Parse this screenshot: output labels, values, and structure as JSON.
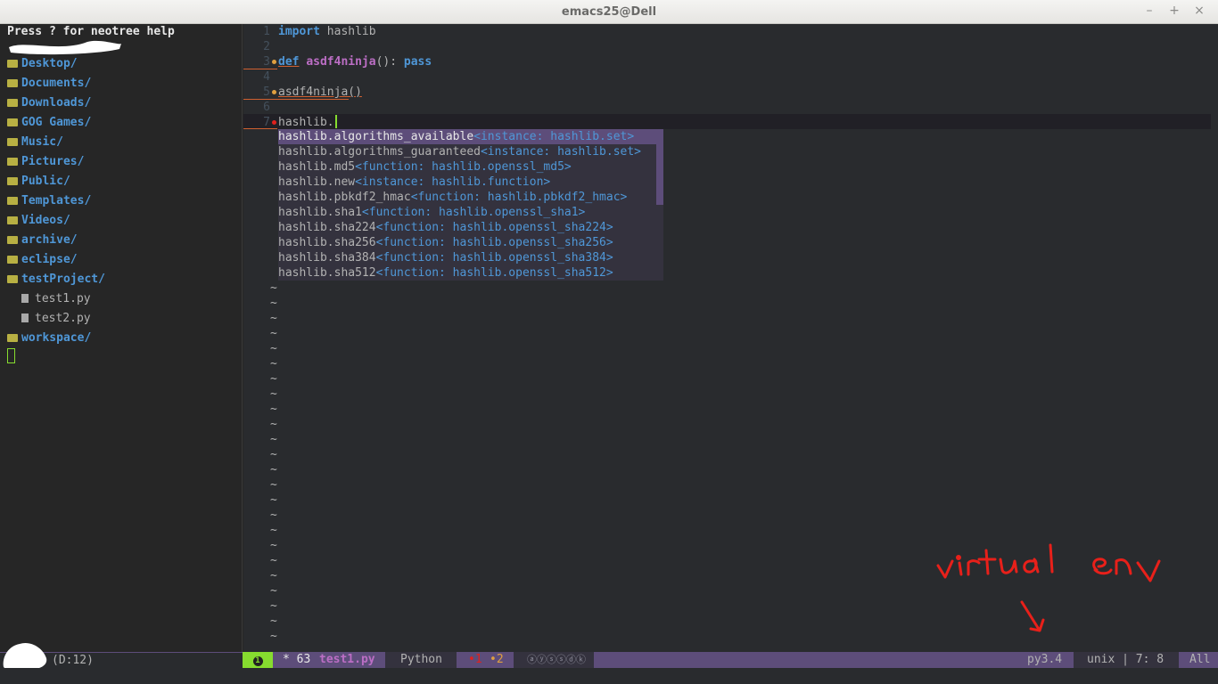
{
  "window": {
    "title": "emacs25@Dell",
    "buttons": [
      "–",
      "+",
      "×"
    ]
  },
  "neotree": {
    "help": "Press ? for neotree help",
    "items": [
      {
        "label": "Desktop/",
        "type": "dir"
      },
      {
        "label": "Documents/",
        "type": "dir"
      },
      {
        "label": "Downloads/",
        "type": "dir"
      },
      {
        "label": "GOG Games/",
        "type": "dir"
      },
      {
        "label": "Music/",
        "type": "dir"
      },
      {
        "label": "Pictures/",
        "type": "dir"
      },
      {
        "label": "Public/",
        "type": "dir"
      },
      {
        "label": "Templates/",
        "type": "dir"
      },
      {
        "label": "Videos/",
        "type": "dir"
      },
      {
        "label": "archive/",
        "type": "dir"
      },
      {
        "label": "eclipse/",
        "type": "dir"
      },
      {
        "label": "testProject/",
        "type": "dir-open"
      },
      {
        "label": "test1.py",
        "type": "file"
      },
      {
        "label": "test2.py",
        "type": "file"
      },
      {
        "label": "workspace/",
        "type": "dir"
      }
    ]
  },
  "editor": {
    "line_numbers": [
      "1",
      "2",
      "3",
      "4",
      "5",
      "6",
      "7"
    ],
    "lines": {
      "l1_kw": "import",
      "l1_rest": " hashlib",
      "l3_kw": "def",
      "l3_fn": "asdf4ninja",
      "l3_rest": "(): ",
      "l3_kw2": "pass",
      "l5": "asdf4ninja()",
      "l7": "hashlib."
    },
    "tilde": "~"
  },
  "completion": {
    "items": [
      {
        "name": "hashlib.algorithms_available",
        "ann": "<instance: hashlib.set>"
      },
      {
        "name": "hashlib.algorithms_guaranteed",
        "ann": "<instance: hashlib.set>"
      },
      {
        "name": "hashlib.md5",
        "ann": "<function: hashlib.openssl_md5>"
      },
      {
        "name": "hashlib.new",
        "ann": "<instance: hashlib.function>"
      },
      {
        "name": "hashlib.pbkdf2_hmac",
        "ann": "<function: hashlib.pbkdf2_hmac>"
      },
      {
        "name": "hashlib.sha1",
        "ann": "<function: hashlib.openssl_sha1>"
      },
      {
        "name": "hashlib.sha224",
        "ann": "<function: hashlib.openssl_sha224>"
      },
      {
        "name": "hashlib.sha256",
        "ann": "<function: hashlib.openssl_sha256>"
      },
      {
        "name": "hashlib.sha384",
        "ann": "<function: hashlib.openssl_sha384>"
      },
      {
        "name": "hashlib.sha512",
        "ann": "<function: hashlib.openssl_sha512>"
      }
    ]
  },
  "modeline": {
    "left_info": "(D:12)",
    "window_num": "1",
    "modified": "* 63",
    "buffer": "test1.py",
    "major_mode": "Python",
    "err": "•1",
    "warn": "•2",
    "minor_modes": "ⓐⓨⓢⓢⓓⓚ",
    "venv": "py3.4",
    "encoding": "unix | 7: 8",
    "position": "All"
  },
  "annotation": {
    "text": "virtual env",
    "arrow": "↘"
  },
  "colors": {
    "keyword": "#4f97d7",
    "function": "#bc6ec5",
    "modeline": "#5d4d7a",
    "cursor": "#86dc2f",
    "annotation": "#e8201a"
  }
}
